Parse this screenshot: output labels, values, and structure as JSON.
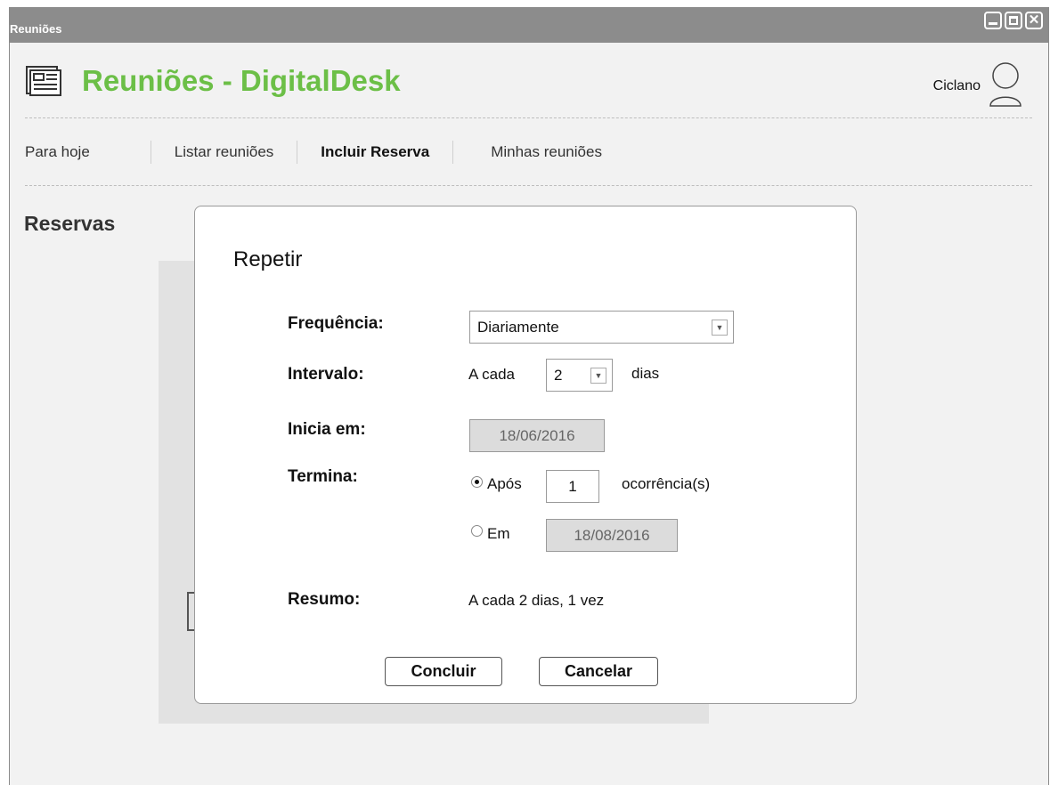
{
  "window": {
    "title": "Reuniões"
  },
  "header": {
    "app_title": "Reuniões - DigitalDesk",
    "user_name": "Ciclano"
  },
  "nav": {
    "items": [
      {
        "label": "Para hoje"
      },
      {
        "label": "Listar reuniões"
      },
      {
        "label": "Incluir Reserva",
        "active": true
      },
      {
        "label": "Minhas reuniões"
      }
    ]
  },
  "section": {
    "title": "Reservas"
  },
  "dialog": {
    "title": "Repetir",
    "frequency": {
      "label": "Frequência:",
      "value": "Diariamente"
    },
    "interval": {
      "label": "Intervalo:",
      "prefix": "A cada",
      "value": "2",
      "suffix": "dias"
    },
    "start": {
      "label": "Inicia em:",
      "value": "18/06/2016"
    },
    "end": {
      "label": "Termina:",
      "after": {
        "label": "Após",
        "value": "1",
        "suffix": "ocorrência(s)",
        "selected": true
      },
      "on": {
        "label": "Em",
        "value": "18/08/2016",
        "selected": false
      }
    },
    "summary": {
      "label": "Resumo:",
      "value": "A cada 2 dias, 1 vez"
    },
    "buttons": {
      "confirm": "Concluir",
      "cancel": "Cancelar"
    }
  }
}
